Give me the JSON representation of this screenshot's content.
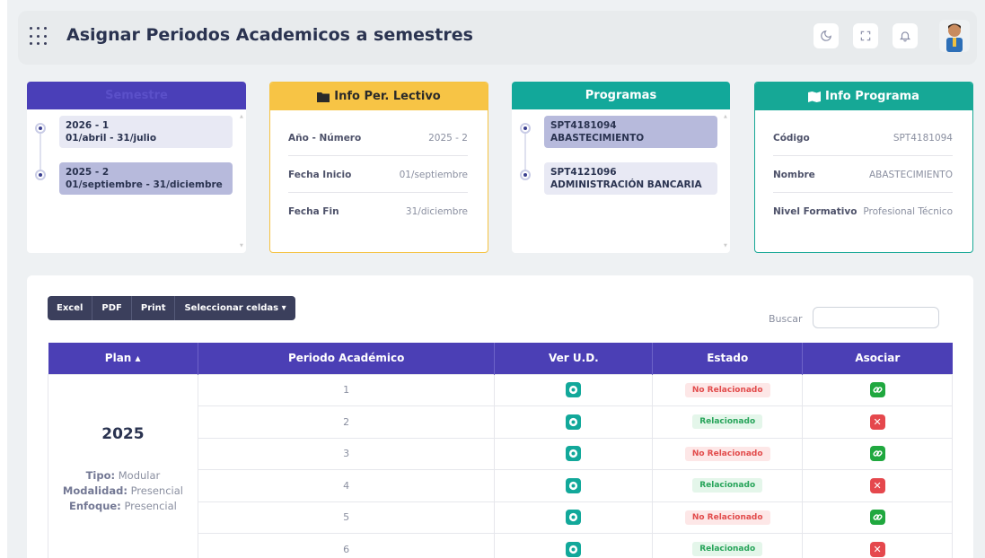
{
  "header": {
    "title": "Asignar Periodos Academicos a semestres"
  },
  "topbar_icons": [
    "grid-icon",
    "moon-icon",
    "fullscreen-icon",
    "bell-icon"
  ],
  "semestre_card": {
    "title": "Semestre",
    "items": [
      {
        "code": "2026 - 1",
        "range": "01/abril - 31/julio"
      },
      {
        "code": "2025 - 2",
        "range": "01/septiembre - 31/diciembre"
      }
    ]
  },
  "info_lectivo": {
    "title": "Info Per. Lectivo",
    "rows": [
      {
        "key": "Año - Número",
        "value": "2025 - 2"
      },
      {
        "key": "Fecha Inicio",
        "value": "01/septiembre"
      },
      {
        "key": "Fecha Fin",
        "value": "31/diciembre"
      }
    ]
  },
  "programas_card": {
    "title": "Programas",
    "items": [
      {
        "code": "SPT4181094",
        "name": "ABASTECIMIENTO"
      },
      {
        "code": "SPT4121096",
        "name": "ADMINISTRACIÓN BANCARIA"
      }
    ]
  },
  "info_programa": {
    "title": "Info Programa",
    "rows": [
      {
        "key": "Código",
        "value": "SPT4181094"
      },
      {
        "key": "Nombre",
        "value": "ABASTECIMIENTO"
      },
      {
        "key": "Nivel Formativo",
        "value": "Profesional Técnico"
      }
    ]
  },
  "toolbar": {
    "excel": "Excel",
    "pdf": "PDF",
    "print": "Print",
    "select_cells": "Seleccionar celdas ▾",
    "search_label": "Buscar"
  },
  "table": {
    "headers": {
      "plan": "Plan ▴",
      "periodo": "Periodo Académico",
      "ver": "Ver U.D.",
      "estado": "Estado",
      "asociar": "Asociar"
    },
    "plan": {
      "year": "2025",
      "tipo_label": "Tipo:",
      "tipo_value": "Modular",
      "modalidad_label": "Modalidad:",
      "modalidad_value": "Presencial",
      "enfoque_label": "Enfoque:",
      "enfoque_value": "Presencial"
    },
    "rows": [
      {
        "periodo": "1",
        "estado": "No Relacionado"
      },
      {
        "periodo": "2",
        "estado": "Relacionado"
      },
      {
        "periodo": "3",
        "estado": "No Relacionado"
      },
      {
        "periodo": "4",
        "estado": "Relacionado"
      },
      {
        "periodo": "5",
        "estado": "No Relacionado"
      },
      {
        "periodo": "6",
        "estado": "Relacionado"
      }
    ]
  },
  "colors": {
    "primary": "#4b3fb5",
    "warning": "#f7c445",
    "teal": "#12a89a",
    "success": "#20a83f",
    "danger": "#e5484d"
  }
}
